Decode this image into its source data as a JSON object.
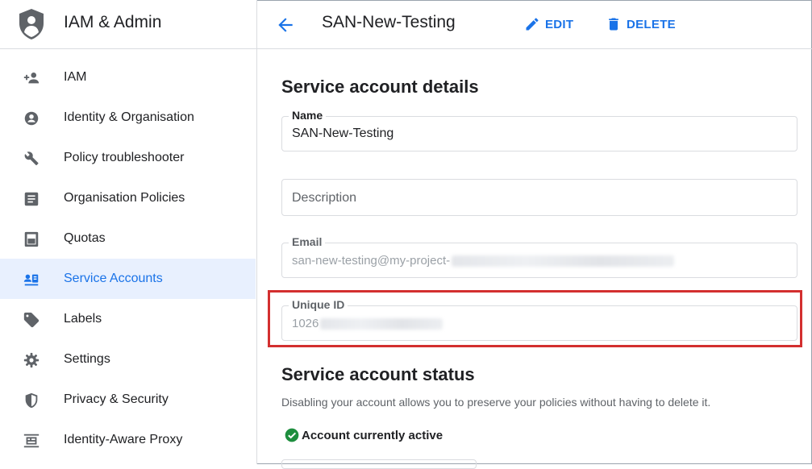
{
  "app": {
    "title": "IAM & Admin",
    "icon": "shield-person-icon"
  },
  "sidebar": {
    "items": [
      {
        "label": "IAM",
        "icon": "person-add-icon",
        "active": false
      },
      {
        "label": "Identity & Organisation",
        "icon": "account-circle-icon",
        "active": false
      },
      {
        "label": "Policy troubleshooter",
        "icon": "wrench-icon",
        "active": false
      },
      {
        "label": "Organisation Policies",
        "icon": "list-document-icon",
        "active": false
      },
      {
        "label": "Quotas",
        "icon": "quota-meter-icon",
        "active": false
      },
      {
        "label": "Service Accounts",
        "icon": "service-account-icon",
        "active": true
      },
      {
        "label": "Labels",
        "icon": "tag-icon",
        "active": false
      },
      {
        "label": "Settings",
        "icon": "gear-icon",
        "active": false
      },
      {
        "label": "Privacy & Security",
        "icon": "shield-icon",
        "active": false
      },
      {
        "label": "Identity-Aware Proxy",
        "icon": "proxy-icon",
        "active": false
      }
    ]
  },
  "header": {
    "page_title": "SAN-New-Testing",
    "edit_label": "EDIT",
    "delete_label": "DELETE"
  },
  "details": {
    "title": "Service account details",
    "name_label": "Name",
    "name_value": "SAN-New-Testing",
    "description_placeholder": "Description",
    "email_label": "Email",
    "email_value": "san-new-testing@my-project-",
    "unique_id_label": "Unique ID",
    "unique_id_value": "1026"
  },
  "status": {
    "title": "Service account status",
    "description": "Disabling your account allows you to preserve your policies without having to delete it.",
    "active_text": "Account currently active"
  },
  "colors": {
    "accent": "#1a73e8",
    "active_bg": "#e8f0fe",
    "highlight_border": "#d32f2f",
    "status_ok": "#1e8e3e",
    "icon_gray": "#5f6368"
  }
}
